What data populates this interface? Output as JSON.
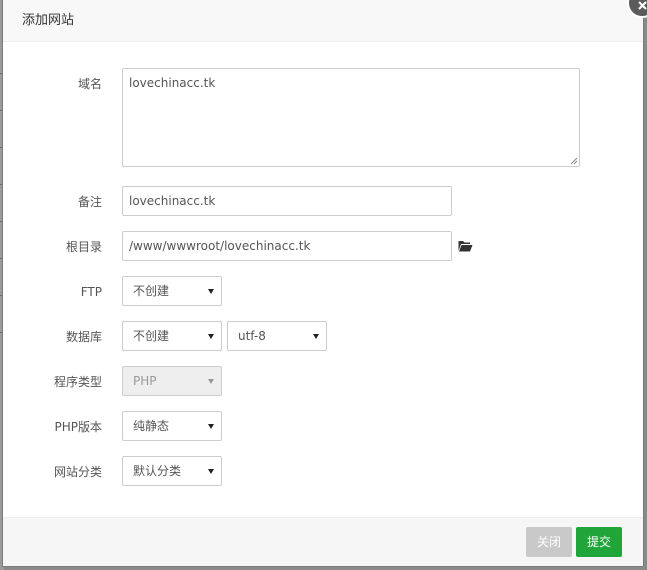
{
  "dialog": {
    "title": "添加网站"
  },
  "form": {
    "domain": {
      "label": "域名",
      "value": "lovechinacc.tk"
    },
    "remark": {
      "label": "备注",
      "value": "lovechinacc.tk"
    },
    "root_dir": {
      "label": "根目录",
      "value": "/www/wwwroot/lovechinacc.tk"
    },
    "ftp": {
      "label": "FTP",
      "selected": "不创建"
    },
    "database": {
      "label": "数据库",
      "selected": "不创建",
      "charset": "utf-8"
    },
    "program_type": {
      "label": "程序类型",
      "selected": "PHP",
      "disabled": true
    },
    "php_version": {
      "label": "PHP版本",
      "selected": "纯静态"
    },
    "site_category": {
      "label": "网站分类",
      "selected": "默认分类"
    }
  },
  "footer": {
    "close_label": "关闭",
    "submit_label": "提交"
  },
  "colors": {
    "submit": "#20a53a",
    "close_disabled": "#c9c9c9",
    "header_bg": "#f8f8f8"
  },
  "icons": {
    "folder": "folder-open-icon",
    "close": "close-icon"
  }
}
